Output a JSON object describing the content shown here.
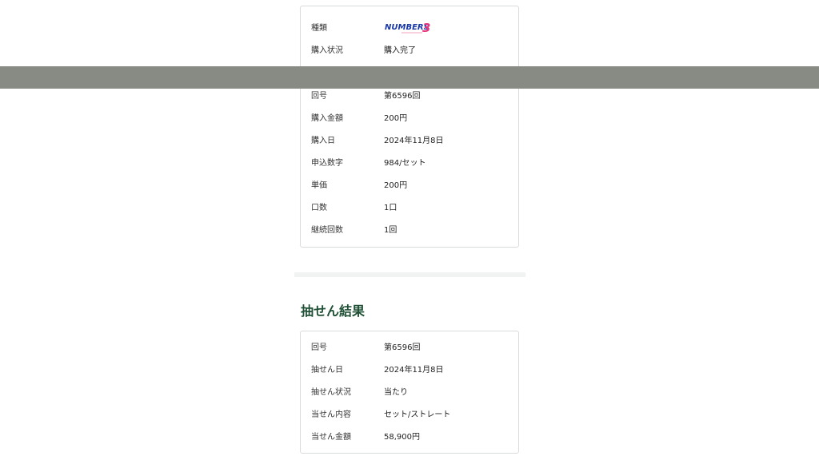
{
  "purchase": {
    "rows": [
      {
        "label": "種類",
        "value": ""
      },
      {
        "label": "購入状況",
        "value": "購入完了"
      },
      {
        "label": "回号",
        "value": "第6596回"
      },
      {
        "label": "購入金額",
        "value": "200円"
      },
      {
        "label": "購入日",
        "value": "2024年11月8日"
      },
      {
        "label": "申込数字",
        "value": "984/セット"
      },
      {
        "label": "単価",
        "value": "200円"
      },
      {
        "label": "口数",
        "value": "1口"
      },
      {
        "label": "継続回数",
        "value": "1回"
      }
    ],
    "logo_text": "NUMBERS",
    "logo_digit": "3"
  },
  "result": {
    "title": "抽せん結果",
    "rows": [
      {
        "label": "回号",
        "value": "第6596回"
      },
      {
        "label": "抽せん日",
        "value": "2024年11月8日"
      },
      {
        "label": "抽せん状況",
        "value": "当たり"
      },
      {
        "label": "当せん内容",
        "value": "セット/ストレート"
      },
      {
        "label": "当せん金額",
        "value": "58,900円"
      }
    ]
  },
  "colors": {
    "accent_green": "#1f4f35",
    "overlay_bar": "#878b83",
    "logo_blue": "#1b3aa8",
    "logo_pink": "#e6337a"
  }
}
